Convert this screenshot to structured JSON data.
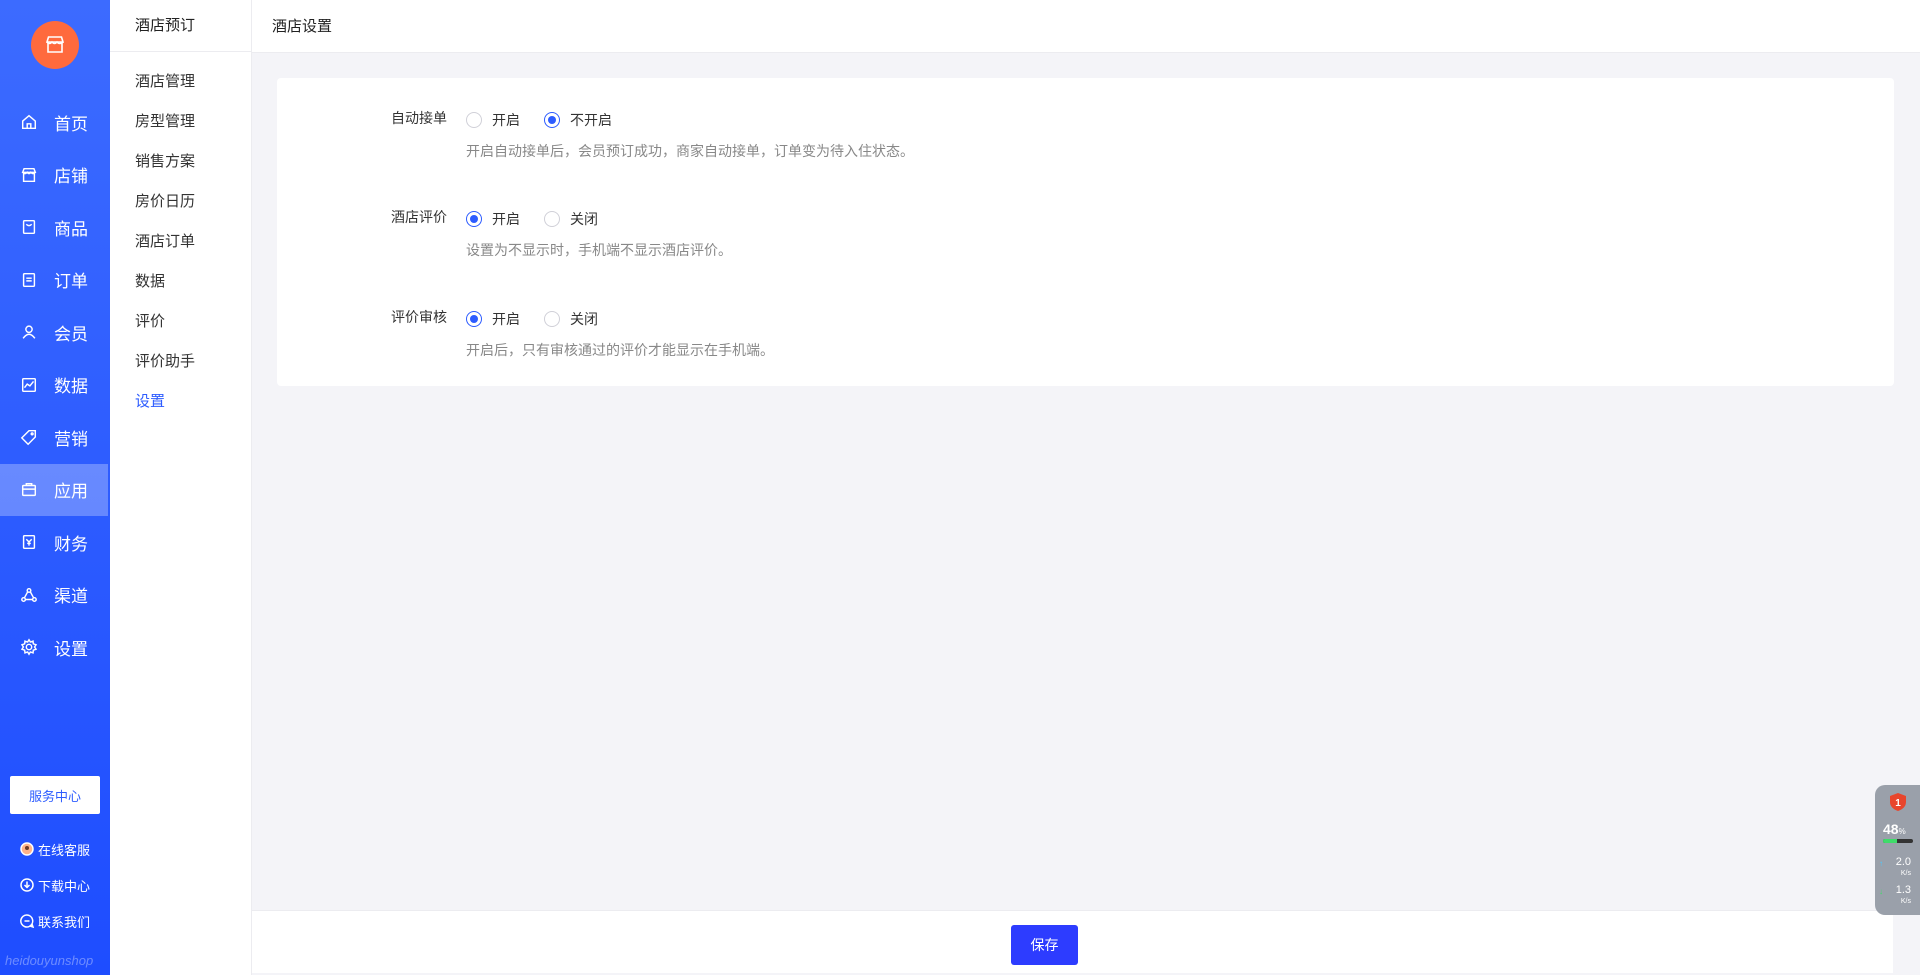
{
  "sidebar": {
    "logo_icon": "store-icon",
    "items": [
      {
        "label": "首页",
        "icon": "home-icon"
      },
      {
        "label": "店铺",
        "icon": "shop-icon"
      },
      {
        "label": "商品",
        "icon": "goods-icon"
      },
      {
        "label": "订单",
        "icon": "order-icon"
      },
      {
        "label": "会员",
        "icon": "user-icon"
      },
      {
        "label": "数据",
        "icon": "chart-icon"
      },
      {
        "label": "营销",
        "icon": "tag-icon"
      },
      {
        "label": "应用",
        "icon": "app-icon",
        "active": true
      },
      {
        "label": "财务",
        "icon": "finance-icon"
      },
      {
        "label": "渠道",
        "icon": "channel-icon"
      },
      {
        "label": "设置",
        "icon": "gear-icon"
      }
    ],
    "service_button": "服务中心",
    "links": [
      {
        "label": "在线客服",
        "icon": "avatar-icon"
      },
      {
        "label": "下载中心",
        "icon": "download-icon"
      },
      {
        "label": "联系我们",
        "icon": "chat-icon"
      }
    ],
    "watermark": "heidouyunshop"
  },
  "subbar": {
    "title": "酒店预订",
    "items": [
      {
        "label": "酒店管理"
      },
      {
        "label": "房型管理"
      },
      {
        "label": "销售方案"
      },
      {
        "label": "房价日历"
      },
      {
        "label": "酒店订单"
      },
      {
        "label": "数据"
      },
      {
        "label": "评价"
      },
      {
        "label": "评价助手"
      },
      {
        "label": "设置",
        "active": true
      }
    ]
  },
  "header": {
    "title": "酒店设置"
  },
  "settings": [
    {
      "label": "自动接单",
      "options": [
        "开启",
        "不开启"
      ],
      "selected": 1,
      "hint": "开启自动接单后，会员预订成功，商家自动接单，订单变为待入住状态。"
    },
    {
      "label": "酒店评价",
      "options": [
        "开启",
        "关闭"
      ],
      "selected": 0,
      "hint": "设置为不显示时，手机端不显示酒店评价。"
    },
    {
      "label": "评价审核",
      "options": [
        "开启",
        "关闭"
      ],
      "selected": 0,
      "hint": "开启后，只有审核通过的评价才能显示在手机端。"
    }
  ],
  "footer": {
    "save_label": "保存"
  },
  "widget": {
    "badge": "1",
    "cpu": "48",
    "cpu_unit": "%",
    "cpu_level": 0.48,
    "upload": "2.0",
    "download": "1.3",
    "speed_unit": "K/s"
  },
  "colors": {
    "primary": "#2d5cff",
    "logo": "#ff6a3d",
    "button": "#2d3cff"
  }
}
